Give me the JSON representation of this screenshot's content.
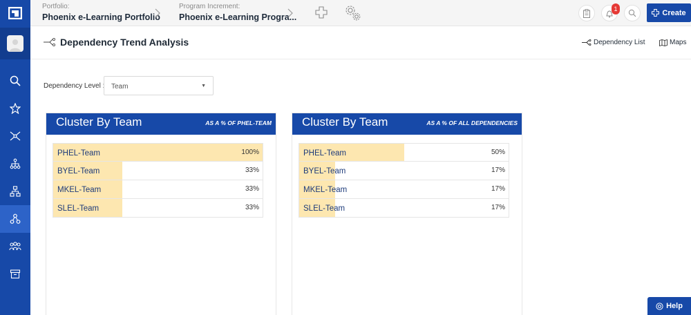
{
  "topbar": {
    "portfolio_label": "Portfolio:",
    "portfolio_value": "Phoenix e-Learning Portfolio",
    "pi_label": "Program Increment:",
    "pi_value": "Phoenix e-Learning Progra...",
    "notification_count": "1",
    "create_label": "Create"
  },
  "page": {
    "title": "Dependency Trend Analysis",
    "link_dependency_list": "Dependency List",
    "link_maps": "Maps"
  },
  "filter": {
    "label": "Dependency Level :",
    "value": "Team"
  },
  "cards": [
    {
      "title": "Cluster By Team",
      "subtitle": "AS A % OF PHEL-TEAM",
      "rows": [
        {
          "name": "PHEL-Team",
          "pct": "100%",
          "value": 100
        },
        {
          "name": "BYEL-Team",
          "pct": "33%",
          "value": 33
        },
        {
          "name": "MKEL-Team",
          "pct": "33%",
          "value": 33
        },
        {
          "name": "SLEL-Team",
          "pct": "33%",
          "value": 33
        }
      ]
    },
    {
      "title": "Cluster By Team",
      "subtitle": "AS A % OF ALL DEPENDENCIES",
      "rows": [
        {
          "name": "PHEL-Team",
          "pct": "50%",
          "value": 50
        },
        {
          "name": "BYEL-Team",
          "pct": "17%",
          "value": 17
        },
        {
          "name": "MKEL-Team",
          "pct": "17%",
          "value": 17
        },
        {
          "name": "SLEL-Team",
          "pct": "17%",
          "value": 17
        }
      ]
    }
  ],
  "help_label": "Help",
  "colors": {
    "brand": "#1749a8",
    "bar_fill": "#fde7b0",
    "badge": "#e53935"
  },
  "icons": {
    "rail": [
      "search-icon",
      "star-icon",
      "network-icon",
      "hierarchy-icon",
      "org-chart-icon",
      "dependency-icon",
      "team-icon",
      "archive-icon"
    ]
  }
}
